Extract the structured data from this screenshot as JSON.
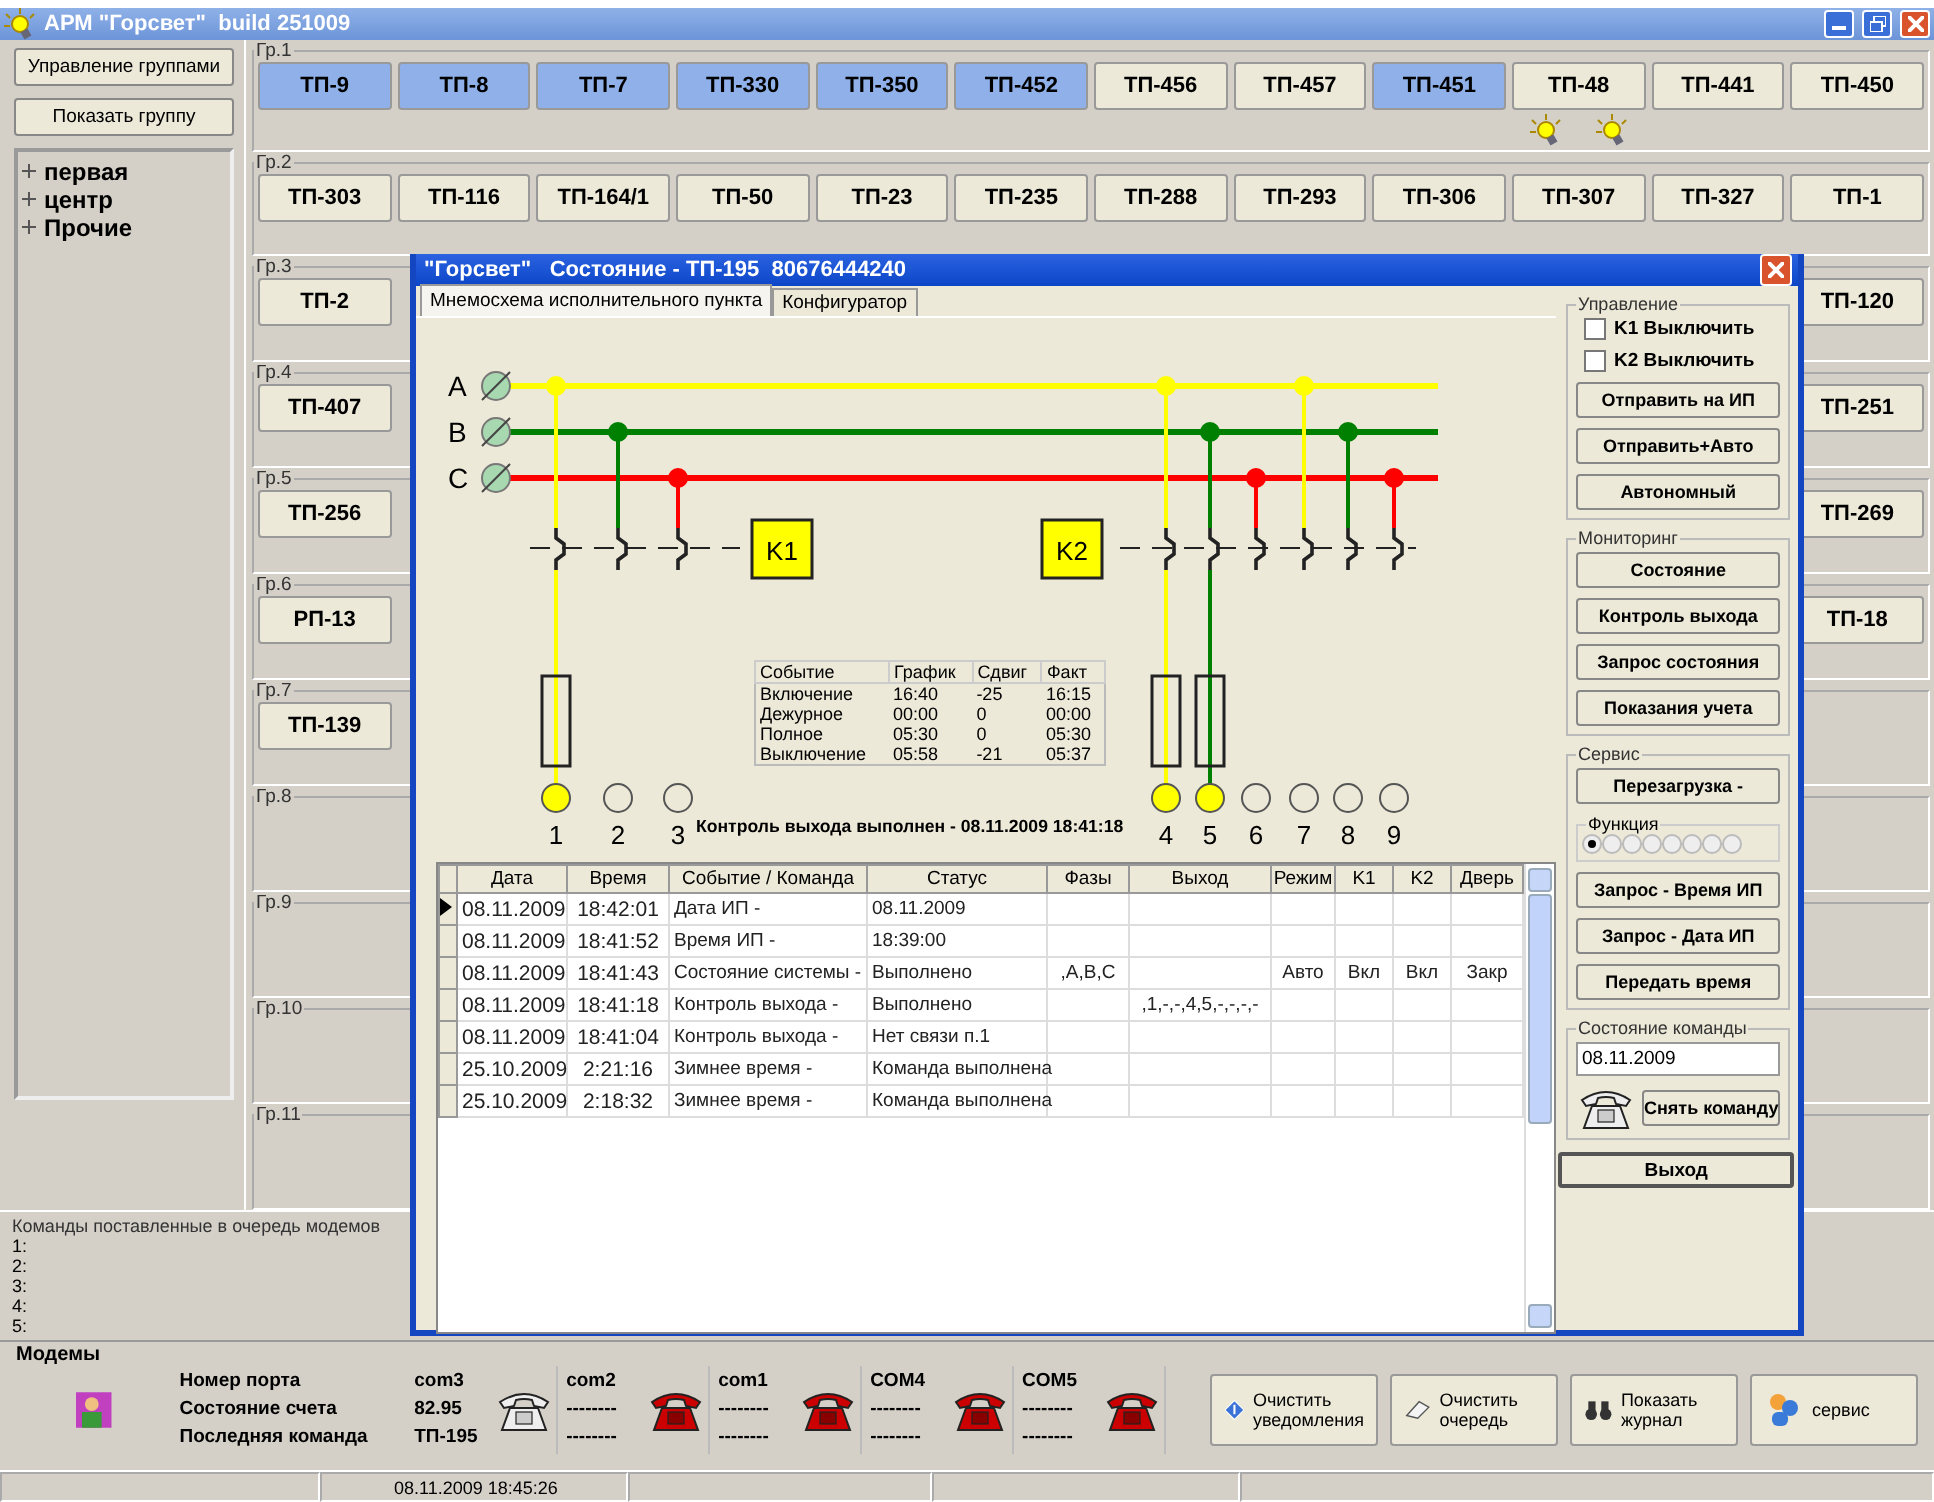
{
  "window": {
    "title": "АРМ \"Горсвет\"  build 251009"
  },
  "left_panel": {
    "buttons": [
      "Управление группами",
      "Показать группу"
    ],
    "tree": [
      {
        "label": "первая",
        "expanded": false
      },
      {
        "label": "центр",
        "expanded": false
      },
      {
        "label": "Прочие",
        "expanded": false
      }
    ]
  },
  "groups": [
    {
      "title": "Гр.1",
      "buttons": [
        {
          "label": "ТП-9",
          "highlighted": true
        },
        {
          "label": "ТП-8",
          "highlighted": true
        },
        {
          "label": "ТП-7",
          "highlighted": true
        },
        {
          "label": "ТП-330",
          "highlighted": true
        },
        {
          "label": "ТП-350",
          "highlighted": true
        },
        {
          "label": "ТП-452",
          "highlighted": true
        },
        {
          "label": "ТП-456",
          "highlighted": false
        },
        {
          "label": "ТП-457",
          "highlighted": false
        },
        {
          "label": "ТП-451",
          "highlighted": true
        },
        {
          "label": "ТП-48",
          "highlighted": false,
          "lamps": [
            {
              "kind": "bulb"
            },
            {
              "kind": "bulb"
            }
          ]
        },
        {
          "label": "ТП-441",
          "highlighted": false
        },
        {
          "label": "ТП-450",
          "highlighted": false
        }
      ]
    },
    {
      "title": "Гр.2",
      "buttons": [
        {
          "label": "ТП-303",
          "highlighted": false
        },
        {
          "label": "ТП-116",
          "highlighted": false
        },
        {
          "label": "ТП-164/1",
          "highlighted": false
        },
        {
          "label": "ТП-50",
          "highlighted": false
        },
        {
          "label": "ТП-23",
          "highlighted": false
        },
        {
          "label": "ТП-235",
          "highlighted": false
        },
        {
          "label": "ТП-288",
          "highlighted": false
        },
        {
          "label": "ТП-293",
          "highlighted": false
        },
        {
          "label": "ТП-306",
          "highlighted": false
        },
        {
          "label": "ТП-307",
          "highlighted": false
        },
        {
          "label": "ТП-327",
          "highlighted": false
        },
        {
          "label": "ТП-1",
          "highlighted": false
        }
      ]
    },
    {
      "title": "Гр.3",
      "buttons": [
        {
          "label": "ТП-2",
          "highlighted": false
        }
      ],
      "end_buttons": [
        {
          "label": "ТП-120",
          "highlighted": false
        }
      ]
    },
    {
      "title": "Гр.4",
      "buttons": [
        {
          "label": "ТП-407",
          "highlighted": false
        }
      ],
      "end_buttons": [
        {
          "label": "ТП-251",
          "highlighted": false
        }
      ]
    },
    {
      "title": "Гр.5",
      "buttons": [
        {
          "label": "ТП-256",
          "highlighted": false
        }
      ],
      "end_buttons": [
        {
          "label": "ТП-269",
          "highlighted": false
        }
      ]
    },
    {
      "title": "Гр.6",
      "buttons": [
        {
          "label": "РП-13",
          "highlighted": false
        }
      ],
      "end_buttons": [
        {
          "label": "ТП-18",
          "highlighted": false
        }
      ]
    },
    {
      "title": "Гр.7",
      "buttons": [
        {
          "label": "ТП-139",
          "highlighted": false
        }
      ]
    },
    {
      "title": "Гр.8"
    },
    {
      "title": "Гр.9"
    },
    {
      "title": "Гр.10"
    },
    {
      "title": "Гр.11"
    }
  ],
  "queue": {
    "title": "Команды поставленные в очередь модемов",
    "lines": [
      "1:",
      "2:",
      "3:",
      "4:",
      "5:"
    ]
  },
  "modems": {
    "title": "Модемы",
    "row_labels": [
      "Номер порта",
      "Состояние счета",
      "Последняя команда"
    ],
    "ports": [
      {
        "port": "com3",
        "balance": "82.95",
        "last_command": "ТП-195",
        "busy": false
      },
      {
        "port": "com2",
        "balance": "--------",
        "last_command": "--------",
        "busy": true
      },
      {
        "port": "com1",
        "balance": "--------",
        "last_command": "--------",
        "busy": true
      },
      {
        "port": "COM4",
        "balance": "--------",
        "last_command": "--------",
        "busy": true
      },
      {
        "port": "COM5",
        "balance": "--------",
        "last_command": "--------",
        "busy": true
      }
    ]
  },
  "actions": [
    {
      "label": "Очистить уведомления",
      "kind": "diamond"
    },
    {
      "label": "Очистить очередь",
      "kind": "eraser"
    },
    {
      "label": "Показать журнал",
      "kind": "binoculars"
    },
    {
      "label": "сервис",
      "kind": "people"
    }
  ],
  "status_bar": {
    "time": "08.11.2009 18:45:26"
  },
  "dialog": {
    "title": "\"Горсвет\"   Состояние - ТП-195  80676444240",
    "tabs": [
      {
        "label": "Мнемосхема исполнительного пункта",
        "selected": true
      },
      {
        "label": "Конфигуратор",
        "selected": false
      }
    ],
    "schematic": {
      "phases": [
        {
          "label": "A",
          "color": "#ffff00"
        },
        {
          "label": "B",
          "color": "#008000"
        },
        {
          "label": "C",
          "color": "#ff0000"
        }
      ],
      "contactors": [
        "K1",
        "K2"
      ],
      "outputs": [
        {
          "label": "1",
          "on": true
        },
        {
          "label": "2",
          "on": false
        },
        {
          "label": "3",
          "on": false
        },
        {
          "label": "4",
          "on": true
        },
        {
          "label": "5",
          "on": true
        },
        {
          "label": "6",
          "on": false
        },
        {
          "label": "7",
          "on": false
        },
        {
          "label": "8",
          "on": false
        },
        {
          "label": "9",
          "on": false
        }
      ],
      "event_table": {
        "columns": [
          "Событие",
          "График",
          "Сдвиг",
          "Факт"
        ],
        "rows": [
          [
            "Включение",
            "16:40",
            "-25",
            "16:15"
          ],
          [
            "Дежурное",
            "00:00",
            "0",
            "00:00"
          ],
          [
            "Полное",
            "05:30",
            "0",
            "05:30"
          ],
          [
            "Выключение",
            "05:58",
            "-21",
            "05:37"
          ]
        ]
      },
      "message": "Контроль выхода выполнен - 08.11.2009 18:41:18"
    },
    "log": {
      "columns": [
        "Дата",
        "Время",
        "Событие / Команда",
        "Статус",
        "Фазы",
        "Выход",
        "Режим",
        "K1",
        "K2",
        "Дверь"
      ],
      "rows": [
        {
          "selected": true,
          "date": "08.11.2009",
          "time": "18:42:01",
          "event": "Дата ИП -",
          "status": "08.11.2009"
        },
        {
          "selected": false,
          "date": "08.11.2009",
          "time": "18:41:52",
          "event": "Время ИП -",
          "status": "18:39:00"
        },
        {
          "selected": false,
          "date": "08.11.2009",
          "time": "18:41:43",
          "event": "Состояние системы -",
          "status": "Выполнено",
          "phases": ",A,B,C",
          "mode": "Авто",
          "k1": "Вкл",
          "k2": "Вкл",
          "door": "Закр"
        },
        {
          "selected": false,
          "date": "08.11.2009",
          "time": "18:41:18",
          "event": "Контроль выхода -",
          "status": "Выполнено",
          "output": ",1,-,-,4,5,-,-,-,-"
        },
        {
          "selected": false,
          "date": "08.11.2009",
          "time": "18:41:04",
          "event": "Контроль выхода -",
          "status": "Нет связи п.1"
        },
        {
          "selected": false,
          "date": "25.10.2009",
          "time": "2:21:16",
          "event": "Зимнее время -",
          "status": "Команда выполнена"
        },
        {
          "selected": false,
          "date": "25.10.2009",
          "time": "2:18:32",
          "event": "Зимнее время -",
          "status": "Команда выполнена"
        }
      ]
    },
    "controls": {
      "sections": [
        {
          "title": "Управление",
          "items": [
            {
              "kind": "checkbox",
              "label": "K1 Выключить",
              "checked": false
            },
            {
              "kind": "checkbox",
              "label": "K2 Выключить",
              "checked": false
            },
            {
              "kind": "button",
              "label": "Отправить на ИП"
            },
            {
              "kind": "button",
              "label": "Отправить+Авто"
            },
            {
              "kind": "button",
              "label": "Автономный"
            }
          ]
        },
        {
          "title": "Мониторинг",
          "items": [
            {
              "kind": "button",
              "label": "Состояние"
            },
            {
              "kind": "button",
              "label": "Контроль выхода"
            },
            {
              "kind": "button",
              "label": "Запрос состояния"
            },
            {
              "kind": "button",
              "label": "Показания учета"
            }
          ]
        },
        {
          "title": "Сервис",
          "items": [
            {
              "kind": "button",
              "label": "Перезагрузка -"
            },
            {
              "kind": "radio_group",
              "title": "Функция",
              "options": [
                {
                  "selected": true
                },
                {
                  "selected": false
                },
                {
                  "selected": false
                },
                {
                  "selected": false
                },
                {
                  "selected": false
                },
                {
                  "selected": false
                },
                {
                  "selected": false
                },
                {
                  "selected": false
                }
              ]
            },
            {
              "kind": "button",
              "label": "Запрос - Время ИП"
            },
            {
              "kind": "button",
              "label": "Запрос  -  Дата ИП"
            },
            {
              "kind": "button",
              "label": "Передать время"
            }
          ]
        },
        {
          "title": "Состояние команды",
          "items": [
            {
              "kind": "field",
              "value": "08.11.2009"
            },
            {
              "kind": "phone_button",
              "label": "Снять команду"
            }
          ]
        }
      ],
      "exit_button": "Выход"
    }
  }
}
